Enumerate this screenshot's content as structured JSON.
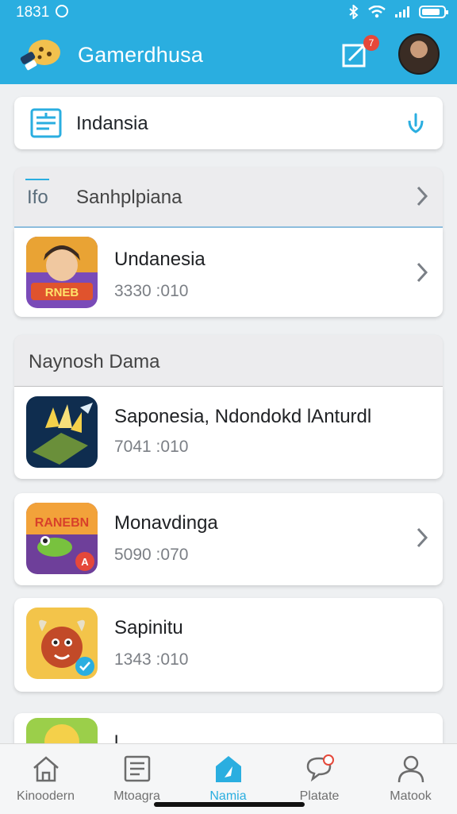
{
  "status_bar": {
    "time": "1831"
  },
  "header": {
    "title": "Gamerdhusa",
    "notification_count": "7"
  },
  "search": {
    "label": "Indansia"
  },
  "section1": {
    "tag": "Ifo",
    "title": "Sanhplpiana",
    "items": [
      {
        "name": "Undanesia",
        "meta": "3330 :010",
        "thumb_text": "RNEB"
      }
    ]
  },
  "section2": {
    "title": "Naynosh Dama",
    "items": [
      {
        "name": "Saponesia, Ndondokd lAnturdl",
        "meta": "7041 :010"
      },
      {
        "name": "Monavdinga",
        "meta": "5090 :070",
        "thumb_text": "RANEBN"
      },
      {
        "name": "Sapinitu",
        "meta": "1343 :010"
      },
      {
        "name": "l",
        "meta": ""
      }
    ]
  },
  "nav": {
    "items": [
      {
        "label": "Kinoodern",
        "icon": "home-icon"
      },
      {
        "label": "Mtoagra",
        "icon": "list-icon"
      },
      {
        "label": "Namia",
        "icon": "store-icon"
      },
      {
        "label": "Platate",
        "icon": "chat-icon"
      },
      {
        "label": "Matook",
        "icon": "profile-icon"
      }
    ]
  },
  "colors": {
    "accent": "#2aaee0",
    "badge": "#e5483a"
  }
}
